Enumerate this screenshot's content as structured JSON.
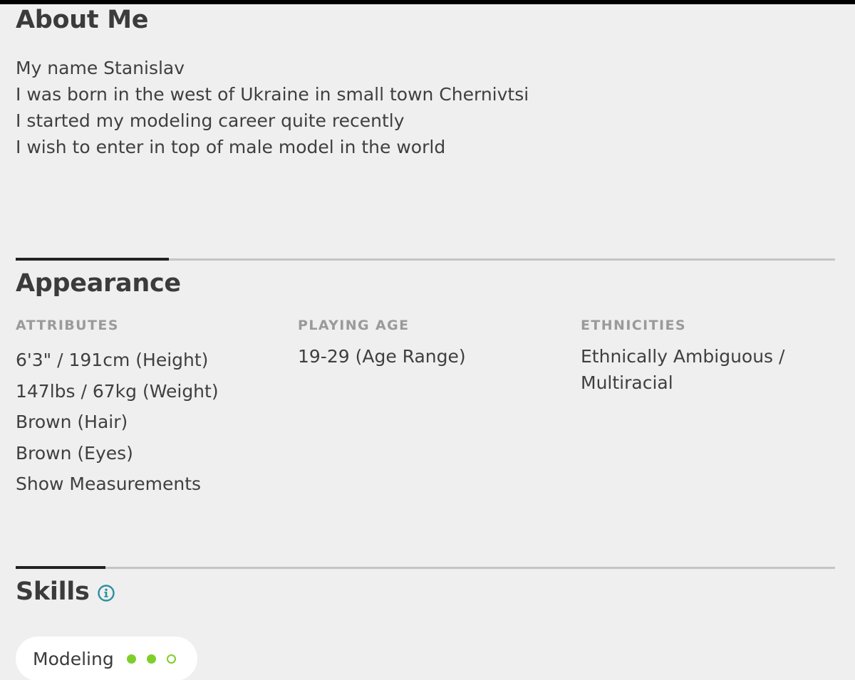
{
  "about": {
    "title": "About Me",
    "lines": [
      "My name Stanislav",
      "I was born in the west of Ukraine in small town Chernivtsi",
      "I started my modeling career quite recently",
      "I wish to enter in top of male model in the world"
    ]
  },
  "appearance": {
    "title": "Appearance",
    "attributes": {
      "heading": "ATTRIBUTES",
      "items": [
        "6'3\" / 191cm (Height)",
        "147lbs / 67kg (Weight)",
        "Brown (Hair)",
        "Brown (Eyes)"
      ],
      "show_measurements": "Show Measurements"
    },
    "playing_age": {
      "heading": "PLAYING AGE",
      "value": "19-29 (Age Range)"
    },
    "ethnicities": {
      "heading": "ETHNICITIES",
      "value_line1": "Ethnically Ambiguous /",
      "value_line2": "Multiracial"
    }
  },
  "skills": {
    "title": "Skills",
    "items": [
      {
        "name": "Modeling",
        "level": 2,
        "max_level": 3
      }
    ]
  },
  "colors": {
    "link": "#2a8fa0",
    "skill_dot": "#7fcf2a",
    "background": "#efefef"
  },
  "icons": {
    "skills_info": "info-circle-icon"
  }
}
